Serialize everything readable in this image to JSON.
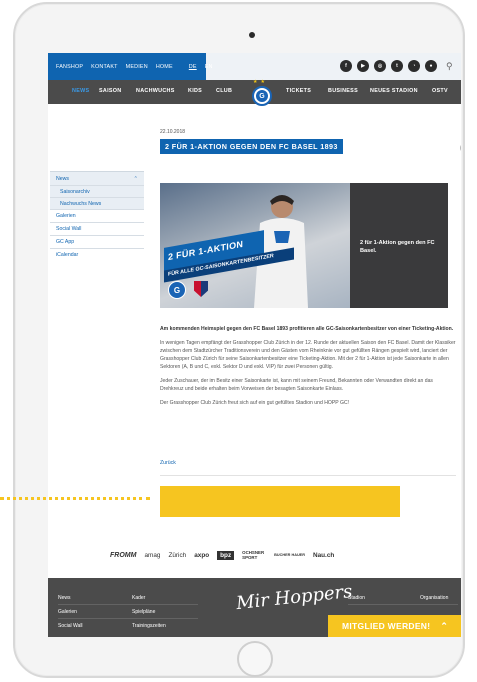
{
  "topbar": {
    "links": [
      "FANSHOP",
      "KONTAKT",
      "MEDIEN",
      "HOME"
    ],
    "lang_de": "DE",
    "lang_en": "EN"
  },
  "mainnav": {
    "items": [
      "NEWS",
      "SAISON",
      "NACHWUCHS",
      "KIDS",
      "CLUB",
      "TICKETS",
      "BUSINESS",
      "NEUES STADION",
      "OSTV"
    ],
    "logo_letter": "G"
  },
  "sidebar": {
    "news": "News",
    "sub": [
      "Saisonarchiv",
      "Nachwuchs News"
    ],
    "items": [
      "Galerien",
      "Social Wall",
      "GC App",
      "iCalendar"
    ]
  },
  "article": {
    "date": "22.10.2018",
    "title": "2 FÜR 1-AKTION GEGEN DEN FC BASEL 1893",
    "hero_banner_big": "2 FÜR 1-AKTION",
    "hero_banner_small": "FÜR ALLE GC-SAISONKARTENBESITZER",
    "hero_caption": "2 für 1-Aktion gegen den FC Basel.",
    "lead": "Am kommenden Heimspiel gegen den FC Basel 1893 profitieren alle GC-Saisonkartenbesitzer von einer Ticketing-Aktion.",
    "p1": "In wenigen Tagen empfängt der Grasshopper Club Zürich in der 12. Runde der aktuellen Saison den FC Basel. Damit der Klassiker zwischen dem Stadtzürcher Traditionsverein und den Gästen vom Rheinknie vor gut gefüllten Rängen gespielt wird, lanciert der Grasshopper Club Zürich für seine Saisonkartenbesitzer eine Ticketing-Aktion. Mit der 2 für 1-Aktion ist jede Saisonkarte in allen Sektoren (A, B und C, exkl. Sektor D und exkl. VIP) für zwei Personen gültig.",
    "p2": "Jeder Zuschauer, der im Besitz einer Saisonkarte ist, kann mit seinem Freund, Bekannten oder Verwandten direkt an das Drehkreuz und beide erhalten beim Vorweisen der besagten Saisonkarte Einlass.",
    "p3": "Der Grasshopper Club Zürich freut sich auf ein gut gefülltes Stadion und HOPP GC!",
    "back": "Zurück"
  },
  "sponsors": [
    "FROMM",
    "amag",
    "Zürich",
    "axpo",
    "bpz",
    "OCHSNER SPORT",
    "BUCHER HAUER",
    "Nau.ch"
  ],
  "footer": {
    "col1": [
      "News",
      "Galerien",
      "Social Wall"
    ],
    "col2": [
      "Kader",
      "Spielpläne",
      "Trainingszeiten"
    ],
    "col3": [
      "Stadion"
    ],
    "col4": [
      "Organisation"
    ],
    "script": "Mir Hoppers",
    "cta": "MITGLIED WERDEN!"
  },
  "colors": {
    "brand_blue": "#0f64b0",
    "nav_dark": "#4b4b4b",
    "accent_yellow": "#f6c520"
  }
}
